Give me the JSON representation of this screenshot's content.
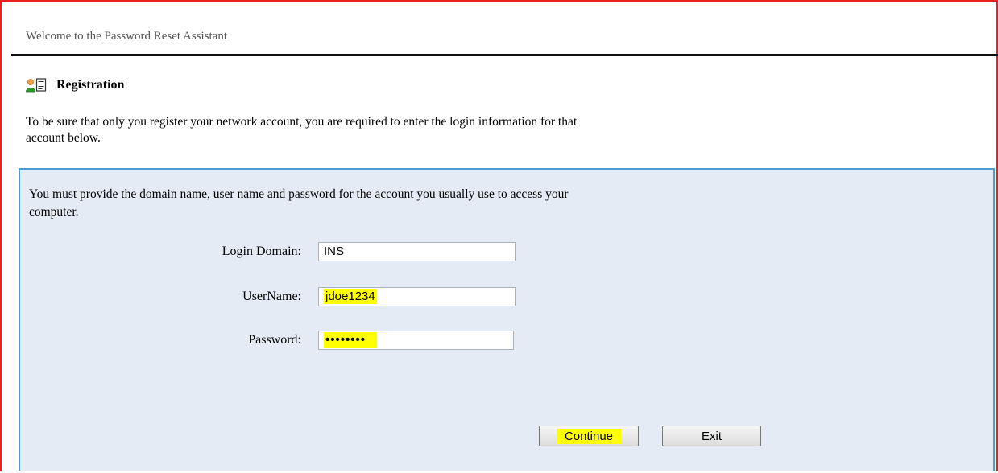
{
  "header": {
    "title": "Welcome to the Password Reset Assistant"
  },
  "section": {
    "title": "Registration",
    "icon": "user-form-icon"
  },
  "intro": {
    "text": "To be sure that only you register your network account, you are required to enter the login information for that account below."
  },
  "panel": {
    "text": "You must provide the domain name, user name and password for the account you usually use to access your computer.",
    "fields": [
      {
        "label": "Login Domain:",
        "value": "INS"
      },
      {
        "label": "UserName:",
        "value": "jdoe1234"
      },
      {
        "label": "Password:",
        "value": "••••••••"
      }
    ]
  },
  "buttons": {
    "continue": "Continue",
    "exit": "Exit"
  },
  "colors": {
    "frame_border": "#e8231f",
    "panel_border": "#4e9bd1",
    "panel_bg": "#e4ebf5",
    "highlight": "#ffff00"
  }
}
